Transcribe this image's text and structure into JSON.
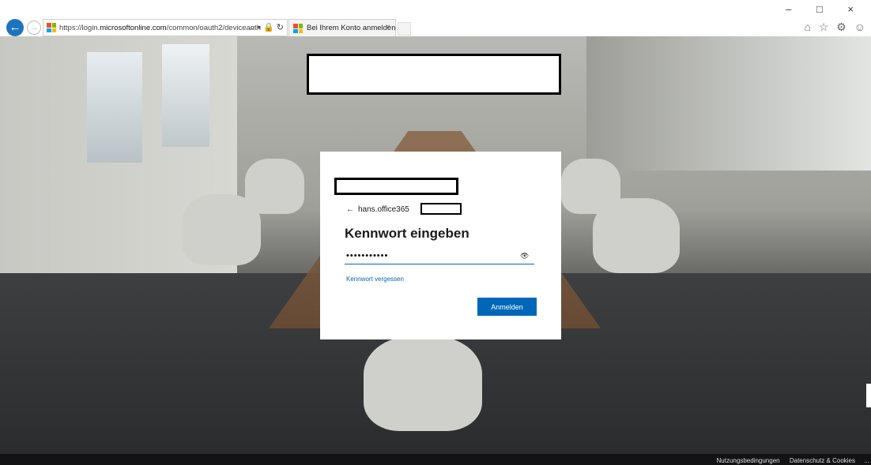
{
  "browser": {
    "url_prefix": "https://login.",
    "url_domain": "microsoftonline.com",
    "url_path": "/common/oauth2/deviceauth",
    "address_icons": "⌕ ▾ 🔒 ↻",
    "tab_title": "Bei Ihrem Konto anmelden",
    "tab_close": "×",
    "window_controls": "– □ ×",
    "toolbar_icons": "⌂ ☆ ⚙ ☺"
  },
  "signin": {
    "back_arrow": "←",
    "username": "hans.office365",
    "title": "Kennwort eingeben",
    "password_masked": "•••••••••••",
    "reveal_icon": "👁",
    "forgot_link": "Kennwort vergessen",
    "submit_label": "Anmelden"
  },
  "footer": {
    "terms": "Nutzungsbedingungen",
    "privacy": "Datenschutz & Cookies",
    "more": "..."
  },
  "colors": {
    "accent": "#0067b8",
    "back_button": "#1e73be"
  }
}
